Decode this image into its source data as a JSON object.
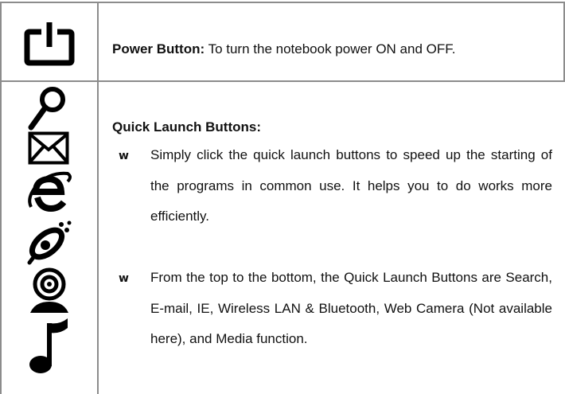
{
  "rows": [
    {
      "icon": "power-icon",
      "title": "Power Button:",
      "text": " To turn the notebook power ON and OFF."
    },
    {
      "icons": [
        "search-icon",
        "email-icon",
        "ie-icon",
        "wireless-lan-bluetooth-icon",
        "web-camera-icon",
        "media-icon"
      ],
      "title": "Quick Launch Buttons:",
      "bullet_glyph": "w",
      "bullets": [
        "Simply click the quick launch buttons to speed up the starting of the programs in common use. It helps you to do works more efficiently.",
        "From the top to the bottom, the Quick Launch Buttons are Search, E-mail, IE, Wireless LAN & Bluetooth, Web Camera (Not available here), and Media function."
      ]
    }
  ]
}
